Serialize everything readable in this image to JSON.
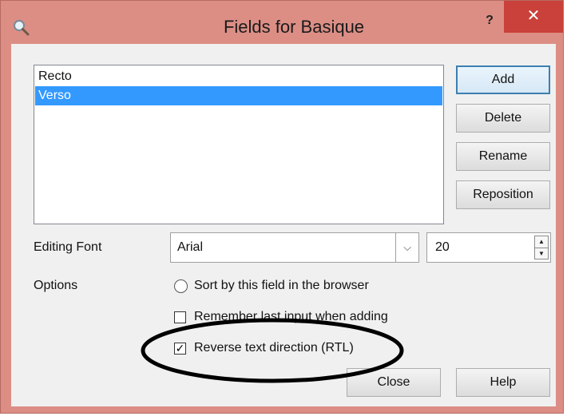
{
  "window": {
    "title": "Fields for Basique",
    "help_label": "?",
    "close_label": "✕",
    "title_icon": "magnifier-icon"
  },
  "fields_list": {
    "items": [
      {
        "label": "Recto",
        "selected": false
      },
      {
        "label": "Verso",
        "selected": true
      }
    ]
  },
  "side_buttons": {
    "add": "Add",
    "delete": "Delete",
    "rename": "Rename",
    "reposition": "Reposition"
  },
  "editing_font": {
    "label": "Editing Font",
    "font_value": "Arial",
    "size_value": "20"
  },
  "options": {
    "label": "Options",
    "sort_label": "Sort by this field in the browser",
    "sort_checked": false,
    "remember_label": "Remember last input when adding",
    "remember_checked": false,
    "rtl_label": "Reverse text direction (RTL)",
    "rtl_checked": true
  },
  "footer": {
    "close": "Close",
    "help": "Help"
  },
  "colors": {
    "titlebar": "#dc8e85",
    "close_button": "#c9413a",
    "selection": "#3399ff",
    "client_bg": "#f0f0f0"
  }
}
